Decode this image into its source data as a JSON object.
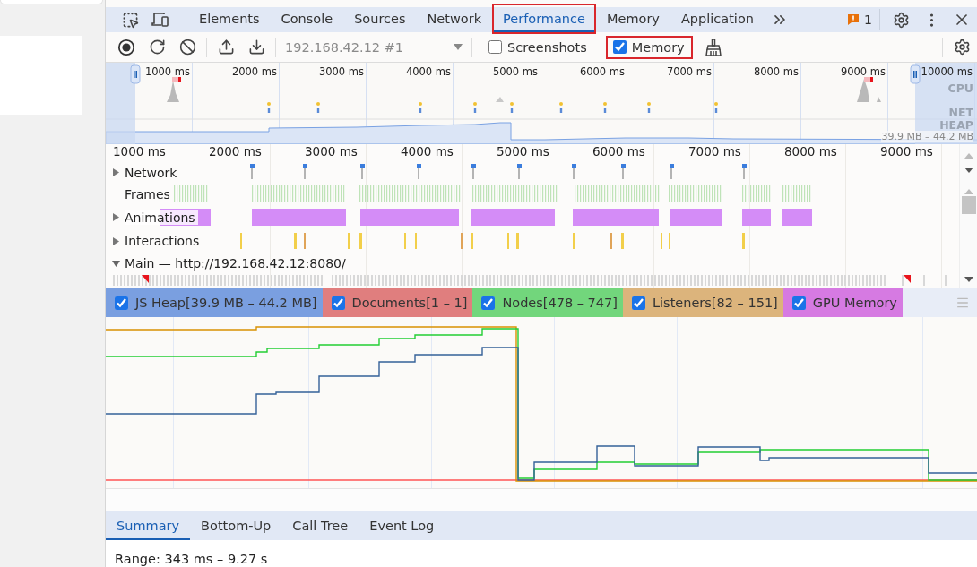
{
  "tabs": [
    {
      "label": "Elements",
      "selected": false,
      "highlighted": false
    },
    {
      "label": "Console",
      "selected": false,
      "highlighted": false
    },
    {
      "label": "Sources",
      "selected": false,
      "highlighted": false
    },
    {
      "label": "Network",
      "selected": false,
      "highlighted": false
    },
    {
      "label": "Performance",
      "selected": true,
      "highlighted": true
    },
    {
      "label": "Memory",
      "selected": false,
      "highlighted": false
    },
    {
      "label": "Application",
      "selected": false,
      "highlighted": false
    }
  ],
  "issues_count": "1",
  "toolbar": {
    "profile_select": "192.168.42.12 #1",
    "options": [
      {
        "label": "Screenshots",
        "checked": false,
        "highlighted": false
      },
      {
        "label": "Memory",
        "checked": true,
        "highlighted": true
      }
    ]
  },
  "overview": {
    "ticks": [
      "1000 ms",
      "2000 ms",
      "3000 ms",
      "4000 ms",
      "5000 ms",
      "6000 ms",
      "7000 ms",
      "8000 ms",
      "9000 ms",
      "10000 ms"
    ],
    "cpu_label": "CPU",
    "heap_label_1": "NET",
    "heap_label_2": "HEAP",
    "heap_range": "39.9 MB – 44.2 MB"
  },
  "timeline": {
    "ticks": [
      "1000 ms",
      "2000 ms",
      "3000 ms",
      "4000 ms",
      "5000 ms",
      "6000 ms",
      "7000 ms",
      "8000 ms",
      "9000 ms"
    ],
    "tracks": [
      {
        "label": "Network",
        "kind": "network",
        "expanded": false
      },
      {
        "label": "Frames",
        "kind": "frames"
      },
      {
        "label": "Animations",
        "kind": "animations",
        "expanded": false
      },
      {
        "label": "Interactions",
        "kind": "interactions",
        "expanded": false
      },
      {
        "label": "Main — http://192.168.42.12:8080/",
        "kind": "main",
        "expanded": true
      }
    ]
  },
  "memory_counters": [
    {
      "label": "JS Heap[39.9 MB – 44.2 MB]",
      "checked": true,
      "color": "#7a9fe0"
    },
    {
      "label": "Documents[1 – 1]",
      "checked": true,
      "color": "#e07e7e"
    },
    {
      "label": "Nodes[478 – 747]",
      "checked": true,
      "color": "#72d67c"
    },
    {
      "label": "Listeners[82 – 151]",
      "checked": true,
      "color": "#dcb47c"
    },
    {
      "label": "GPU Memory",
      "checked": true,
      "color": "#d67ae2"
    }
  ],
  "bottom_tabs": [
    {
      "label": "Summary",
      "selected": true
    },
    {
      "label": "Bottom-Up",
      "selected": false
    },
    {
      "label": "Call Tree",
      "selected": false
    },
    {
      "label": "Event Log",
      "selected": false
    }
  ],
  "summary": {
    "range": "Range: 343 ms – 9.27 s"
  }
}
